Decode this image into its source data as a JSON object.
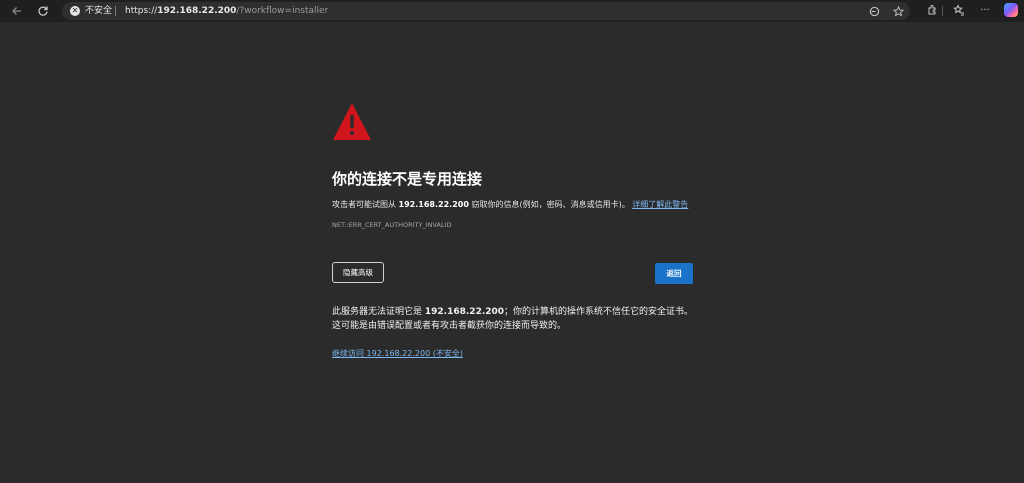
{
  "browser": {
    "insecure_label": "不安全",
    "url_scheme": "https://",
    "url_host": "192.168.22.200",
    "url_path": "/?workflow=installer"
  },
  "page": {
    "heading": "你的连接不是专用连接",
    "desc_prefix": "攻击者可能试图从",
    "desc_host": "192.168.22.200",
    "desc_suffix": "窃取你的信息(例如，密码、消息或信用卡)。",
    "details_link": "详细了解此警告",
    "error_code": "NET::ERR_CERT_AUTHORITY_INVALID",
    "hide_advanced_label": "隐藏高级",
    "back_label": "返回",
    "explain_prefix": "此服务器无法证明它是",
    "explain_host": "192.168.22.200",
    "explain_suffix": "；你的计算机的操作系统不信任它的安全证书。这可能是由错误配置或者有攻击者截获你的连接而导致的。",
    "proceed_link": "继续访问 192.168.22.200 (不安全)"
  },
  "colors": {
    "background": "#2b2b2b",
    "warning_red": "#d0161c",
    "primary_button": "#1a73c9",
    "link": "#7cb7f2"
  },
  "icons": {
    "back": "arrow-left-icon",
    "reload": "reload-icon",
    "insecure": "not-secure-icon",
    "warning": "warning-triangle-icon"
  }
}
